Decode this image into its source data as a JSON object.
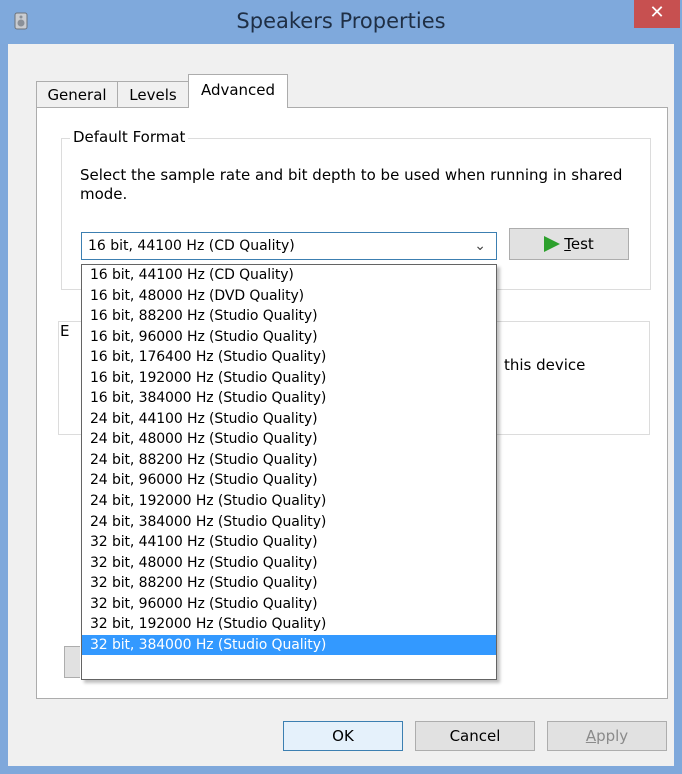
{
  "window": {
    "title": "Speakers Properties",
    "close_glyph": "✕"
  },
  "tabs": [
    {
      "label": "General"
    },
    {
      "label": "Levels"
    },
    {
      "label": "Advanced"
    }
  ],
  "default_format": {
    "group_title": "Default Format",
    "description": "Select the sample rate and bit depth to be used when running in shared mode.",
    "selected": "16 bit, 44100 Hz (CD Quality)",
    "chevron_glyph": "⌄",
    "test_label_underlined": "T",
    "test_label_rest": "est"
  },
  "dropdown": {
    "options": [
      "16 bit, 44100 Hz (CD Quality)",
      "16 bit, 48000 Hz (DVD Quality)",
      "16 bit, 88200 Hz (Studio Quality)",
      "16 bit, 96000 Hz (Studio Quality)",
      "16 bit, 176400 Hz (Studio Quality)",
      "16 bit, 192000 Hz (Studio Quality)",
      "16 bit, 384000 Hz (Studio Quality)",
      "24 bit, 44100 Hz (Studio Quality)",
      "24 bit, 48000 Hz (Studio Quality)",
      "24 bit, 88200 Hz (Studio Quality)",
      "24 bit, 96000 Hz (Studio Quality)",
      "24 bit, 192000 Hz (Studio Quality)",
      "24 bit, 384000 Hz (Studio Quality)",
      "32 bit, 44100 Hz (Studio Quality)",
      "32 bit, 48000 Hz (Studio Quality)",
      "32 bit, 88200 Hz (Studio Quality)",
      "32 bit, 96000 Hz (Studio Quality)",
      "32 bit, 192000 Hz (Studio Quality)",
      "32 bit, 384000 Hz (Studio Quality)"
    ],
    "highlighted_option": "32 bit, 384000 Hz (Studio Quality)"
  },
  "exclusive_mode": {
    "partial_letter": "E",
    "partial_text": "this device"
  },
  "buttons": {
    "ok": "OK",
    "cancel": "Cancel",
    "apply_underlined": "A",
    "apply_rest": "pply"
  },
  "colors": {
    "title_bar": "#7fa9dc",
    "close_button": "#c75050",
    "selection": "#3399ff",
    "test_icon": "#2ca02c"
  }
}
